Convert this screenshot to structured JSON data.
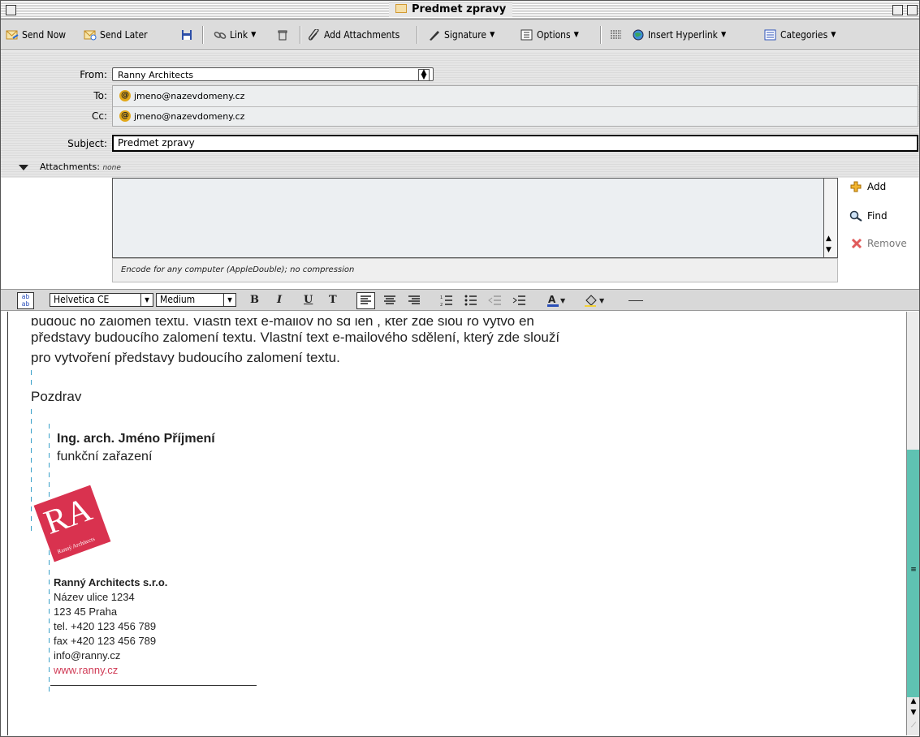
{
  "window": {
    "title": "Predmet zpravy"
  },
  "toolbar": {
    "send_now": "Send Now",
    "send_later": "Send Later",
    "link": "Link",
    "add_attachments": "Add Attachments",
    "signature": "Signature",
    "options": "Options",
    "insert_hyperlink": "Insert Hyperlink",
    "categories": "Categories"
  },
  "header": {
    "from_label": "From:",
    "from_value": "Ranny Architects",
    "to_label": "To:",
    "to_value": "jmeno@nazevdomeny.cz",
    "cc_label": "Cc:",
    "cc_value": "jmeno@nazevdomeny.cz",
    "subject_label": "Subject:",
    "subject_value": "Predmet zpravy"
  },
  "attachments": {
    "label": "Attachments:",
    "value": "none",
    "encode": "Encode for any computer (AppleDouble); no compression",
    "add": "Add",
    "find": "Find",
    "remove": "Remove"
  },
  "format": {
    "font": "Helvetica CE",
    "size": "Medium",
    "bold": "B",
    "italic": "I",
    "underline": "U",
    "teletype": "T"
  },
  "message": {
    "line0": "budouc ho zalomen  textu. Vlastn  text e-mailov  ho sd  len , kter   zde slou     ro vytvo en",
    "line1": "představy budoucího zalomení textu. Vlastní text e-mailového sdělení, který zde slouží",
    "line2": "pro vytvoření představy budoucího zalomení textu.",
    "greeting": "Pozdrav",
    "sig_name": "Ing. arch. Jméno Příjmení",
    "sig_position": "funkční zařazení",
    "logo_letters": "RA",
    "logo_caption": "Ranný Architects",
    "company": "Ranný Architects s.r.o.",
    "street": "Název ulice 1234",
    "city": "123 45 Praha",
    "tel": "tel. +420 123 456 789",
    "fax": "fax +420 123 456 789",
    "email": "info@ranny.cz",
    "web": "www.ranny.cz"
  },
  "colors": {
    "logo_red": "#d9324f",
    "link_red": "#d03a55",
    "scroll_teal": "#5fc2b2",
    "guide_blue": "#39a0c8"
  }
}
